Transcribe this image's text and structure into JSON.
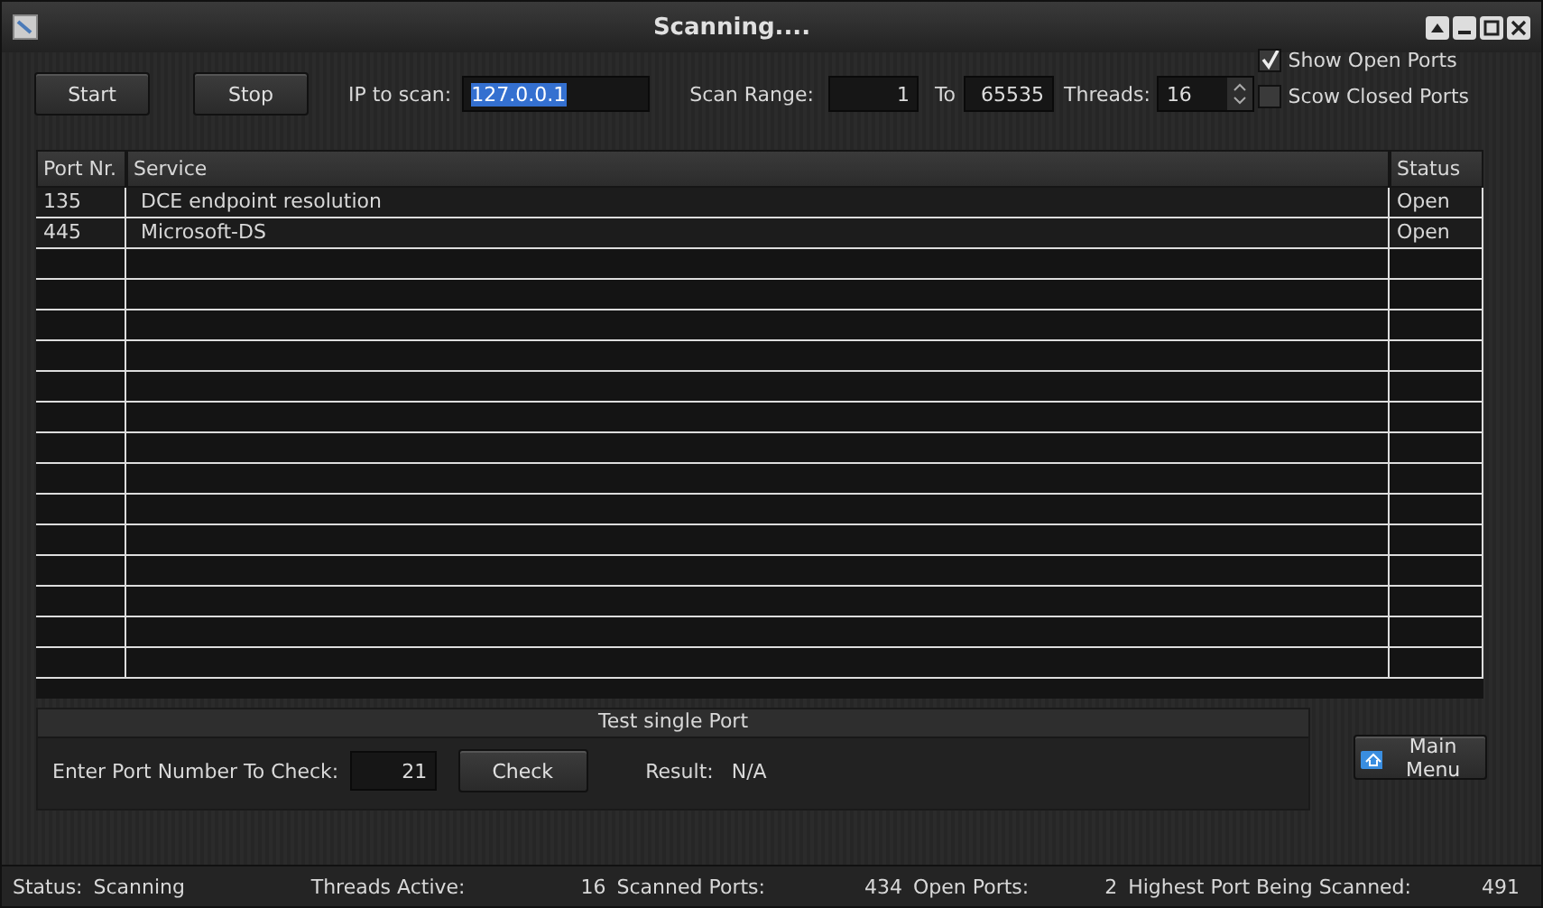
{
  "window": {
    "title": "Scanning...."
  },
  "toolbar": {
    "start": "Start",
    "stop": "Stop",
    "ip_label": "IP to scan:",
    "ip_value": "127.0.0.1",
    "range_label": "Scan Range:",
    "range_from": "1",
    "to_label": "To",
    "range_to": "65535",
    "threads_label": "Threads:",
    "threads_value": "16"
  },
  "options": [
    {
      "label": "Show Open Ports",
      "checked": true
    },
    {
      "label": "Scow Closed Ports",
      "checked": false
    }
  ],
  "table": {
    "columns": [
      "Port Nr.",
      "Service",
      "Status"
    ],
    "rows": [
      {
        "port": "135",
        "service": "DCE endpoint resolution",
        "status": "Open"
      },
      {
        "port": "445",
        "service": "Microsoft-DS",
        "status": "Open"
      }
    ]
  },
  "single_port": {
    "title": "Test single Port",
    "label": "Enter Port Number To Check:",
    "value": "21",
    "button": "Check",
    "result_label": "Result:",
    "result_value": "N/A"
  },
  "main_menu": "Main Menu",
  "status_bar": [
    {
      "label": "Status:",
      "value": "Scanning"
    },
    {
      "label": "Threads Active:",
      "value": "16"
    },
    {
      "label": "Scanned Ports:",
      "value": "434"
    },
    {
      "label": "Open Ports:",
      "value": "2"
    },
    {
      "label": "Highest Port Being Scanned:",
      "value": "491"
    }
  ]
}
